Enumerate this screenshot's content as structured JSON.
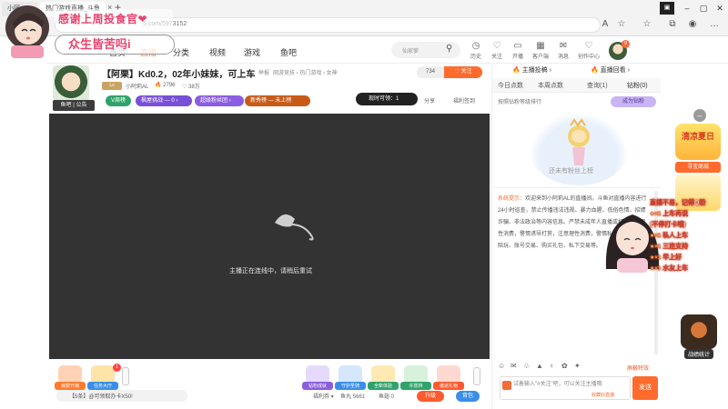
{
  "browser": {
    "tab1_label": "小阿",
    "tab2_label": "热门游戏直播_斗鱼",
    "tab_close": "×",
    "tab_new": "+",
    "ext_label": "▣",
    "min": "–",
    "max": "▢",
    "close": "✕",
    "url": "5.com/5973152"
  },
  "overlay": {
    "top_text": "感谢上周投食官❤",
    "mid_text": "众生皆苦吗i"
  },
  "nav": {
    "items": [
      "直播",
      "首页",
      "直播",
      "分类",
      "视频",
      "游戏",
      "鱼吧"
    ],
    "search_placeholder": "仙家萝",
    "icons": [
      {
        "glyph": "◷",
        "label": "历史"
      },
      {
        "glyph": "♡",
        "label": "关注"
      },
      {
        "glyph": "▭",
        "label": "开播"
      },
      {
        "glyph": "▦",
        "label": "客户端"
      },
      {
        "glyph": "✉",
        "label": "消息"
      },
      {
        "glyph": "♡",
        "label": "创作中心"
      }
    ],
    "avatar_badge": "9"
  },
  "streamer": {
    "avatar_tag": "鱼吧 | 公告",
    "title": "【阿栗】Kd0.2，02年小妹妹，可上车",
    "report": "举报",
    "crumbs": "网游竞技 › 热门游戏 › 女神",
    "follow_count": "734",
    "follow_label": "♡ 关注",
    "level_badge": "Lv",
    "name": "小阿莉AL",
    "hot": "🔥 2796",
    "fans": "♡ 38万",
    "pills": [
      "V周榜",
      "枫屋挑战 — 0 ›",
      "超级粉丝团 ›",
      "新秀榜 — 未上榜"
    ],
    "time_label": "现时可领：1",
    "share": "分享",
    "prank": "福利签到"
  },
  "video": {
    "message": "主播正在连线中，请稍后重试"
  },
  "giftbar": {
    "left_items": [
      {
        "label": "我要开播",
        "color": "#ff7a2d"
      },
      {
        "label": "任务大厅",
        "color": "#3b8ee8"
      }
    ],
    "right_items": [
      {
        "label": "钻粉成就",
        "color": "#8a5de0"
      },
      {
        "label": "守护圣骑",
        "color": "#3b8ee8"
      },
      {
        "label": "全新体验",
        "color": "#2fa36a"
      },
      {
        "label": "许愿林",
        "color": "#2fa36a"
      },
      {
        "label": "邀返礼物",
        "color": "#ff5a2d"
      }
    ],
    "notice_badge": "1",
    "hint": "【5条】@可领取办卡X50!",
    "fishball_label": "福利券 ▾",
    "fishball_val": "鱼丸 5661",
    "fishtail_val": "鱼翅 0",
    "upgrade": "升级",
    "bag": "背包"
  },
  "rightpanel": {
    "top1": "🔥 主播投稿 ›",
    "top2": "🔥 直播回看 ›",
    "tabs": [
      "今日点数",
      "本周点数",
      "查询(1)",
      "钻粉(0)"
    ],
    "rank_line": "按照钻粉等级排行",
    "become_noble": "成为钻粉",
    "empty_text": "还未有粉丝上榜",
    "sys_tag": "系统提示：",
    "sys_msg": "欢迎来到小阿莉AL的直播间。斗鱼对直播内容进行24小时巡查，禁止传播违法违规、暴力血腥、低俗色情、招嫖诈骗、非法政治等内容信息。严禁未成年人直播或打赏。请理性消费，警惕诱导打赏，注意理性消费，警惕私下交易、游戏陪玩、账号交易、购买礼包、私下交易等。",
    "shield": "屏蔽特效",
    "input_placeholder": "试着输入\"#关注\"吧，可以关注主播哦",
    "input_badge_hint": "收藏好直播",
    "send": "发送",
    "toolbar_glyphs": [
      "☺",
      "✉",
      "♧",
      "▲",
      "♀",
      "✿",
      "✦"
    ]
  },
  "rail": {
    "promo_text": "清凉夏日",
    "promo_label": "寻宝商城",
    "battle_label": "战绩统计"
  },
  "danmaku": [
    {
      "pre": "",
      "text": "直播不易，记得Q粉"
    },
    {
      "pre": "★×1",
      "text": "上车再说"
    },
    {
      "pre": "",
      "text": "(不停打卡哦)"
    },
    {
      "pre": "★×1",
      "text": "私人上车"
    },
    {
      "pre": "★×1",
      "text": "三连支持"
    },
    {
      "pre": "★×1",
      "text": "早上好"
    },
    {
      "pre": "★×1",
      "text": "水友上车"
    }
  ]
}
